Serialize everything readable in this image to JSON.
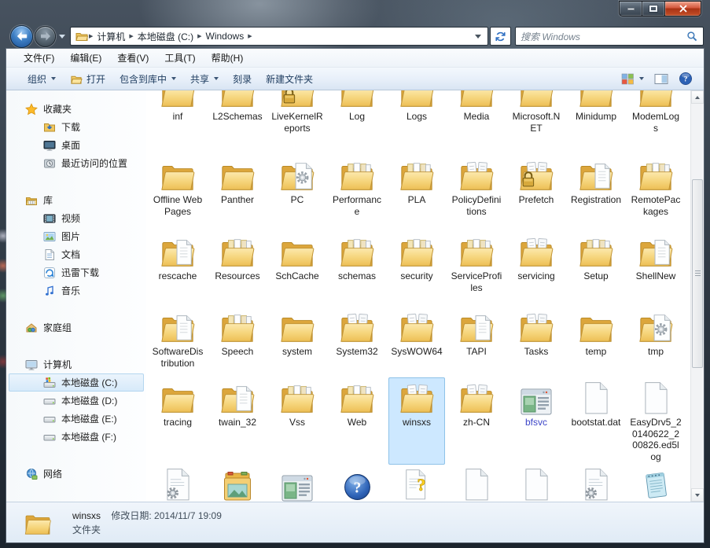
{
  "navbar": {
    "breadcrumb": [
      "计算机",
      "本地磁盘 (C:)",
      "Windows"
    ],
    "separator": "▶",
    "search_placeholder": "搜索 Windows"
  },
  "menubar": {
    "items": [
      "文件(F)",
      "编辑(E)",
      "查看(V)",
      "工具(T)",
      "帮助(H)"
    ]
  },
  "toolbar": {
    "items": [
      {
        "label": "组织",
        "key": "organize",
        "dropdown": true
      },
      {
        "label": "打开",
        "key": "open",
        "icon": "open-folder-icon"
      },
      {
        "label": "包含到库中",
        "key": "include-in-library",
        "dropdown": true
      },
      {
        "label": "共享",
        "key": "share",
        "dropdown": true
      },
      {
        "label": "刻录",
        "key": "burn"
      },
      {
        "label": "新建文件夹",
        "key": "new-folder"
      }
    ]
  },
  "sidebar": {
    "groups": [
      {
        "label": "收藏夹",
        "key": "favorites",
        "icon": "favorites-star-icon",
        "items": [
          {
            "label": "下载",
            "key": "downloads",
            "icon": "downloads-folder-icon"
          },
          {
            "label": "桌面",
            "key": "desktop",
            "icon": "desktop-icon"
          },
          {
            "label": "最近访问的位置",
            "key": "recent-places",
            "icon": "recent-places-icon"
          }
        ]
      },
      {
        "label": "库",
        "key": "libraries",
        "icon": "libraries-icon",
        "items": [
          {
            "label": "视频",
            "key": "videos",
            "icon": "videos-icon"
          },
          {
            "label": "图片",
            "key": "pictures",
            "icon": "pictures-icon"
          },
          {
            "label": "文档",
            "key": "documents",
            "icon": "documents-icon"
          },
          {
            "label": "迅雷下载",
            "key": "thunder-downloads",
            "icon": "thunder-download-icon"
          },
          {
            "label": "音乐",
            "key": "music",
            "icon": "music-icon"
          }
        ]
      },
      {
        "label": "家庭组",
        "key": "homegroup",
        "icon": "homegroup-icon",
        "items": []
      },
      {
        "label": "计算机",
        "key": "computer",
        "icon": "computer-icon",
        "items": [
          {
            "label": "本地磁盘 (C:)",
            "key": "local-disk-c",
            "icon": "system-drive-icon",
            "selected": true
          },
          {
            "label": "本地磁盘 (D:)",
            "key": "local-disk-d",
            "icon": "drive-icon"
          },
          {
            "label": "本地磁盘 (E:)",
            "key": "local-disk-e",
            "icon": "drive-icon"
          },
          {
            "label": "本地磁盘 (F:)",
            "key": "local-disk-f",
            "icon": "drive-icon"
          }
        ]
      },
      {
        "label": "网络",
        "key": "network",
        "icon": "network-icon",
        "items": []
      }
    ]
  },
  "files": {
    "rows": [
      [
        {
          "label": "inf",
          "icon": "folder-docs-icon"
        },
        {
          "label": "L2Schemas",
          "icon": "folder-docs-icon"
        },
        {
          "label": "LiveKernelReports",
          "icon": "folder-lock-icon"
        },
        {
          "label": "Log",
          "icon": "folder-icon"
        },
        {
          "label": "Logs",
          "icon": "folder-docs-icon"
        },
        {
          "label": "Media",
          "icon": "folder-media-icon"
        },
        {
          "label": "Microsoft.NET",
          "icon": "folder-docs-icon"
        },
        {
          "label": "Minidump",
          "icon": "folder-icon"
        },
        {
          "label": "ModemLogs",
          "icon": "folder-icon"
        }
      ],
      [
        {
          "label": "Offline Web Pages",
          "icon": "folder-icon"
        },
        {
          "label": "Panther",
          "icon": "folder-icon"
        },
        {
          "label": "PC",
          "icon": "folder-gear-doc-icon"
        },
        {
          "label": "Performance",
          "icon": "folder-files-icon"
        },
        {
          "label": "PLA",
          "icon": "folder-files-icon"
        },
        {
          "label": "PolicyDefinitions",
          "icon": "folder-docs-icon"
        },
        {
          "label": "Prefetch",
          "icon": "folder-lock-icon"
        },
        {
          "label": "Registration",
          "icon": "folder-doc-icon"
        },
        {
          "label": "RemotePackages",
          "icon": "folder-files-icon"
        }
      ],
      [
        {
          "label": "rescache",
          "icon": "folder-doc-icon"
        },
        {
          "label": "Resources",
          "icon": "folder-files-icon"
        },
        {
          "label": "SchCache",
          "icon": "folder-icon"
        },
        {
          "label": "schemas",
          "icon": "folder-files-icon"
        },
        {
          "label": "security",
          "icon": "folder-files-icon"
        },
        {
          "label": "ServiceProfiles",
          "icon": "folder-files-icon"
        },
        {
          "label": "servicing",
          "icon": "folder-docs-icon"
        },
        {
          "label": "Setup",
          "icon": "folder-files-icon"
        },
        {
          "label": "ShellNew",
          "icon": "folder-doc-icon"
        }
      ],
      [
        {
          "label": "SoftwareDistribution",
          "icon": "folder-doc-icon"
        },
        {
          "label": "Speech",
          "icon": "folder-files-icon"
        },
        {
          "label": "system",
          "icon": "folder-icon"
        },
        {
          "label": "System32",
          "icon": "folder-docs-icon"
        },
        {
          "label": "SysWOW64",
          "icon": "folder-docs-icon"
        },
        {
          "label": "TAPI",
          "icon": "folder-doc-icon"
        },
        {
          "label": "Tasks",
          "icon": "folder-docs-icon"
        },
        {
          "label": "temp",
          "icon": "folder-icon"
        },
        {
          "label": "tmp",
          "icon": "folder-gear-doc-icon"
        }
      ],
      [
        {
          "label": "tracing",
          "icon": "folder-icon"
        },
        {
          "label": "twain_32",
          "icon": "folder-doc-icon"
        },
        {
          "label": "Vss",
          "icon": "folder-files-icon"
        },
        {
          "label": "Web",
          "icon": "folder-files-icon"
        },
        {
          "label": "winsxs",
          "icon": "folder-docs-icon",
          "selected": true
        },
        {
          "label": "zh-CN",
          "icon": "folder-docs-icon"
        },
        {
          "label": "bfsvc",
          "icon": "app-window-icon",
          "blue": true
        },
        {
          "label": "bootstat.dat",
          "icon": "file-icon"
        },
        {
          "label": "EasyDrv5_20140622_200826.ed5log",
          "icon": "file-icon"
        }
      ],
      [
        {
          "label": "",
          "icon": "file-gear-icon"
        },
        {
          "label": "",
          "icon": "installer-box-icon"
        },
        {
          "label": "",
          "icon": "app-window-icon"
        },
        {
          "label": "",
          "icon": "help-icon"
        },
        {
          "label": "",
          "icon": "help-doc-icon"
        },
        {
          "label": "",
          "icon": "file-icon"
        },
        {
          "label": "",
          "icon": "file-icon"
        },
        {
          "label": "",
          "icon": "file-gear-icon"
        },
        {
          "label": "",
          "icon": "notepad-icon"
        }
      ]
    ]
  },
  "statusbar": {
    "name": "winsxs",
    "modified_label": "修改日期:",
    "modified_value": "2014/11/7 19:09",
    "type": "文件夹"
  },
  "colors": {
    "selection_fill": "#cde8ff",
    "selection_border": "#8ec2e8",
    "close_button": "#c44f28",
    "folder_yellow": "#f3cd6b",
    "compressed_label_blue": "#3c45c8",
    "toolbar_text": "#1e3c5f"
  }
}
